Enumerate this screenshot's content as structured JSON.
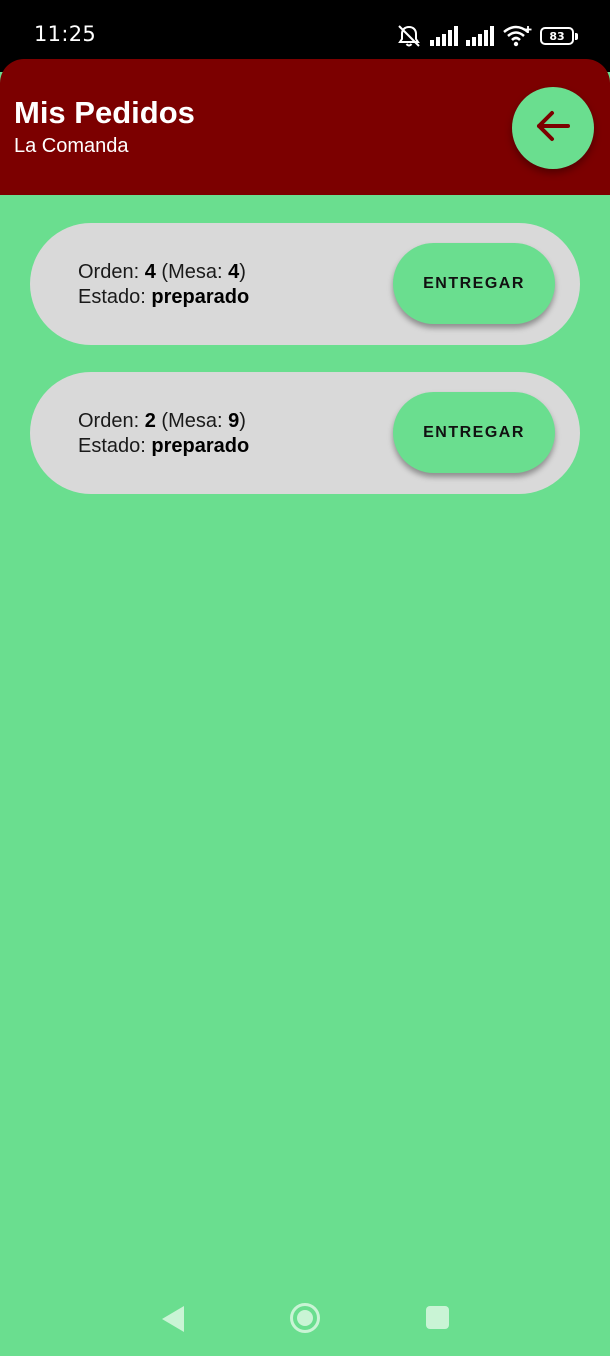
{
  "status_bar": {
    "time": "11:25",
    "battery": "83",
    "icons": [
      "bell-off-icon",
      "signal-icon",
      "signal-icon",
      "wifi-icon",
      "battery-icon"
    ]
  },
  "header": {
    "title": "Mis Pedidos",
    "subtitle": "La Comanda",
    "back_icon": "arrow-left-icon"
  },
  "labels": {
    "order": "Orden:",
    "table_open": "(Mesa:",
    "table_close": ")",
    "status": "Estado:"
  },
  "orders": [
    {
      "order": "4",
      "table": "4",
      "status": "preparado",
      "action": "ENTREGAR"
    },
    {
      "order": "2",
      "table": "9",
      "status": "preparado",
      "action": "ENTREGAR"
    }
  ],
  "nav_bar": {
    "icons": [
      "back-triangle-icon",
      "home-circle-icon",
      "recents-square-icon"
    ]
  },
  "colors": {
    "background": "#6ade8f",
    "header": "#7c0000",
    "card": "#d9d9d9",
    "button": "#6ade8f"
  }
}
